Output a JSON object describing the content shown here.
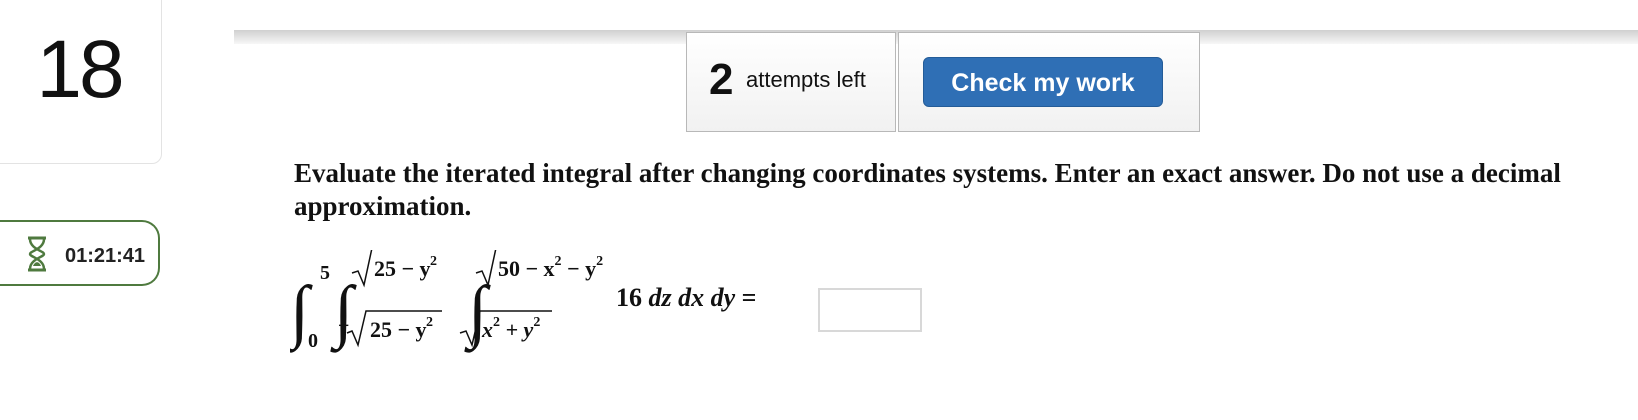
{
  "question": {
    "number": "18"
  },
  "timer": {
    "icon": "hourglass-icon",
    "value": "01:21:41"
  },
  "attempts": {
    "count": "2",
    "label": "attempts left"
  },
  "check_button": {
    "label": "Check my work"
  },
  "prompt": {
    "text": "Evaluate the iterated integral after changing coordinates systems. Enter an exact answer. Do not use a decimal approximation."
  },
  "integral": {
    "int1_upper": "5",
    "int1_lower": "0",
    "int2_upper": "25 − y",
    "int2_lower_neg": "−",
    "int2_lower": "25 − y",
    "int3_upper": "50 − x",
    "int3_upper_minus_y": " − y",
    "int3_lower_x": "x",
    "int3_lower_plus_y": " + y",
    "exp": "2",
    "integrand": "16",
    "dz": "dz",
    "dx": "dx",
    "dy": "dy",
    "equals": "="
  },
  "answer_field": {
    "value": ""
  },
  "colors": {
    "accent": "#2f6fb5",
    "timer_border": "#4f7a3f"
  }
}
